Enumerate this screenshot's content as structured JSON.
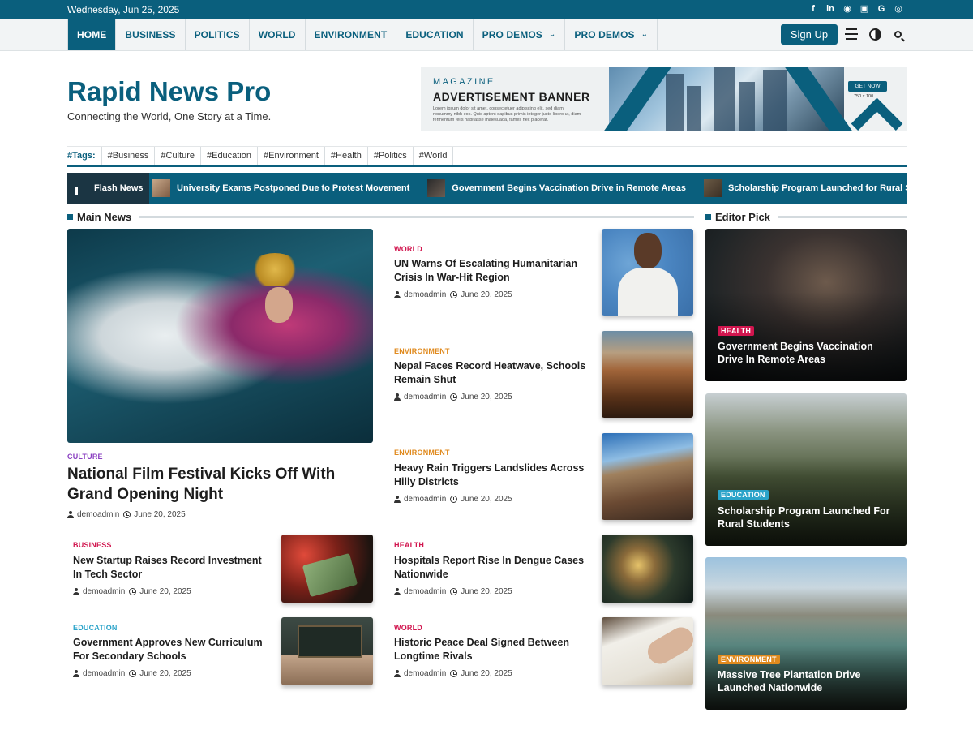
{
  "topbar": {
    "date": "Wednesday, Jun 25, 2025",
    "social_icons": [
      "facebook-icon",
      "linkedin-icon",
      "reddit-icon",
      "twitch-icon",
      "google-icon",
      "instagram-icon"
    ]
  },
  "nav": {
    "items": [
      {
        "label": "HOME",
        "active": true
      },
      {
        "label": "BUSINESS"
      },
      {
        "label": "POLITICS"
      },
      {
        "label": "WORLD"
      },
      {
        "label": "ENVIRONMENT"
      },
      {
        "label": "EDUCATION"
      },
      {
        "label": "PRO DEMOS",
        "dropdown": true
      },
      {
        "label": "PRO DEMOS",
        "dropdown": true
      }
    ],
    "signup": "Sign Up"
  },
  "header": {
    "title": "Rapid News Pro",
    "tagline": "Connecting the World, One Story at a Time."
  },
  "ad": {
    "magazine": "MAGAZINE",
    "banner": "ADVERTISEMENT BANNER",
    "lorem": "Lorem ipsum dolor sit amet, consectetuer adipiscing elit, sed diam nonummy nibh eos. Quis aptent dapibus primis integer justo libero ut, diam fermentum felis habitasse malesuada, fames nec placerat.",
    "get_now": "GET NOW",
    "size": "750 x 100"
  },
  "tags": {
    "label": "#Tags:",
    "items": [
      "#Business",
      "#Culture",
      "#Education",
      "#Environment",
      "#Health",
      "#Politics",
      "#World"
    ]
  },
  "flash": {
    "label": "Flash News",
    "items": [
      "University Exams Postponed Due to Protest Movement",
      "Government Begins Vaccination Drive in Remote Areas",
      "Scholarship Program Launched for Rural Stu"
    ]
  },
  "main": {
    "heading": "Main News",
    "feature": {
      "category": "CULTURE",
      "title": "National Film Festival Kicks Off With Grand Opening Night",
      "author": "demoadmin",
      "date": "June 20, 2025"
    },
    "small": [
      {
        "category": "BUSINESS",
        "title": "New Startup Raises Record Investment In Tech Sector",
        "author": "demoadmin",
        "date": "June 20, 2025"
      },
      {
        "category": "EDUCATION",
        "title": "Government Approves New Curriculum For Secondary Schools",
        "author": "demoadmin",
        "date": "June 20, 2025"
      }
    ],
    "list": [
      {
        "category": "WORLD",
        "title": "UN Warns Of Escalating Humanitarian Crisis In War-Hit Region",
        "author": "demoadmin",
        "date": "June 20, 2025"
      },
      {
        "category": "ENVIRONMENT",
        "title": "Nepal Faces Record Heatwave, Schools Remain Shut",
        "author": "demoadmin",
        "date": "June 20, 2025"
      },
      {
        "category": "ENVIRONMENT",
        "title": "Heavy Rain Triggers Landslides Across Hilly Districts",
        "author": "demoadmin",
        "date": "June 20, 2025"
      },
      {
        "category": "HEALTH",
        "title": "Hospitals Report Rise In Dengue Cases Nationwide",
        "author": "demoadmin",
        "date": "June 20, 2025"
      },
      {
        "category": "WORLD",
        "title": "Historic Peace Deal Signed Between Longtime Rivals",
        "author": "demoadmin",
        "date": "June 20, 2025"
      }
    ]
  },
  "editor": {
    "heading": "Editor Pick",
    "cards": [
      {
        "category": "HEALTH",
        "title": "Government Begins Vaccination Drive In Remote Areas"
      },
      {
        "category": "EDUCATION",
        "title": "Scholarship Program Launched For Rural Students"
      },
      {
        "category": "ENVIRONMENT",
        "title": "Massive Tree Plantation Drive Launched Nationwide"
      }
    ]
  },
  "colors": {
    "brand": "#0a5f7d",
    "world": "#d1154e",
    "environment": "#e08a1e",
    "business": "#d1154e",
    "education": "#2aa3c9",
    "health": "#d1154e",
    "culture": "#8a3fc1"
  }
}
